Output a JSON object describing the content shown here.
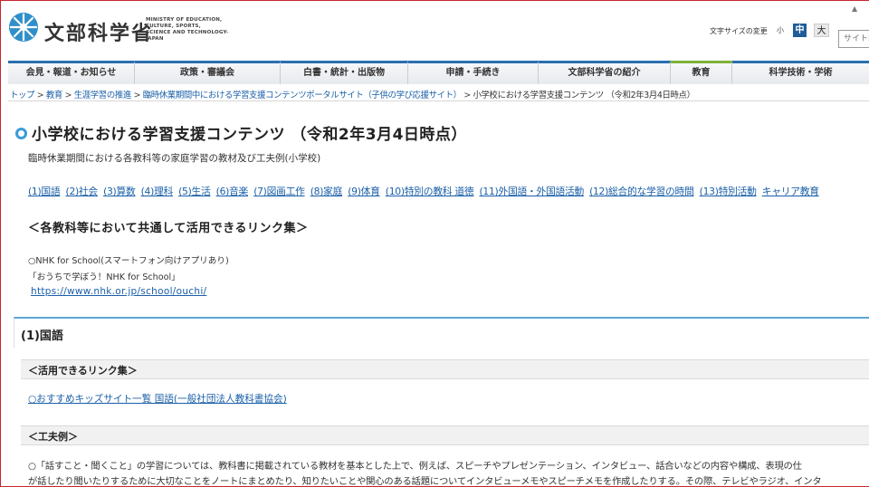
{
  "header": {
    "title": "文部科学省",
    "subtitle_lines": [
      "MINISTRY OF EDUCATION,",
      "CULTURE, SPORTS,",
      "SCIENCE AND TECHNOLOGY-JAPAN"
    ],
    "text_size_label": "文字サイズの変更",
    "text_size_small": "小",
    "text_size_medium": "中",
    "text_size_large": "大",
    "search_placeholder": "サイト内"
  },
  "nav": {
    "items": [
      {
        "label": "会見・報道・お知らせ"
      },
      {
        "label": "政策・審議会"
      },
      {
        "label": "白書・統計・出版物"
      },
      {
        "label": "申請・手続き"
      },
      {
        "label": "文部科学省の紹介"
      },
      {
        "label": "教育"
      },
      {
        "label": "科学技術・学術"
      }
    ]
  },
  "breadcrumb": {
    "items": [
      "トップ",
      "教育",
      "生涯学習の推進",
      "臨時休業期間中における学習支援コンテンツポータルサイト（子供の学び応援サイト）"
    ],
    "current": "小学校における学習支援コンテンツ （令和2年3月4日時点）",
    "separator": ">"
  },
  "page": {
    "title": "小学校における学習支援コンテンツ （令和2年3月4日時点）",
    "subtitle": "臨時休業期間における各教科等の家庭学習の教材及び工夫例(小学校)",
    "subject_links": [
      "(1)国語",
      "(2)社会",
      "(3)算数",
      "(4)理科",
      "(5)生活",
      "(6)音楽",
      "(7)図画工作",
      "(8)家庭",
      "(9)体育",
      "(10)特別の教科 道徳",
      "(11)外国語・外国語活動",
      "(12)総合的な学習の時間",
      "(13)特別活動",
      "キャリア教育"
    ],
    "common_heading": "＜各教科等において共通して活用できるリンク集＞",
    "nhk_line1": "○NHK for School(スマートフォン向けアプリあり)",
    "nhk_line2": "「おうちで学ぼう！NHK for School」",
    "nhk_url": "https://www.nhk.or.jp/school/ouchi/"
  },
  "section1": {
    "title": "(1)国語",
    "links_heading": "＜活用できるリンク集＞",
    "kids_link": "○おすすめキッズサイト一覧 国語(一般社団法人教科書協会)",
    "examples_heading": "＜工夫例＞",
    "body_line1": "○「話すこと・聞くこと」の学習については、教科書に掲載されている教材を基本とした上で、例えば、スピーチやプレゼンテーション、インタビュー、話合いなどの内容や構成、表現の仕",
    "body_line2": "が話したり聞いたりするために大切なことをノートにまとめたり、知りたいことや関心のある話題についてインタビューメモやスピーチメモを作成したりする。その際、テレビやラジオ、インタ"
  }
}
